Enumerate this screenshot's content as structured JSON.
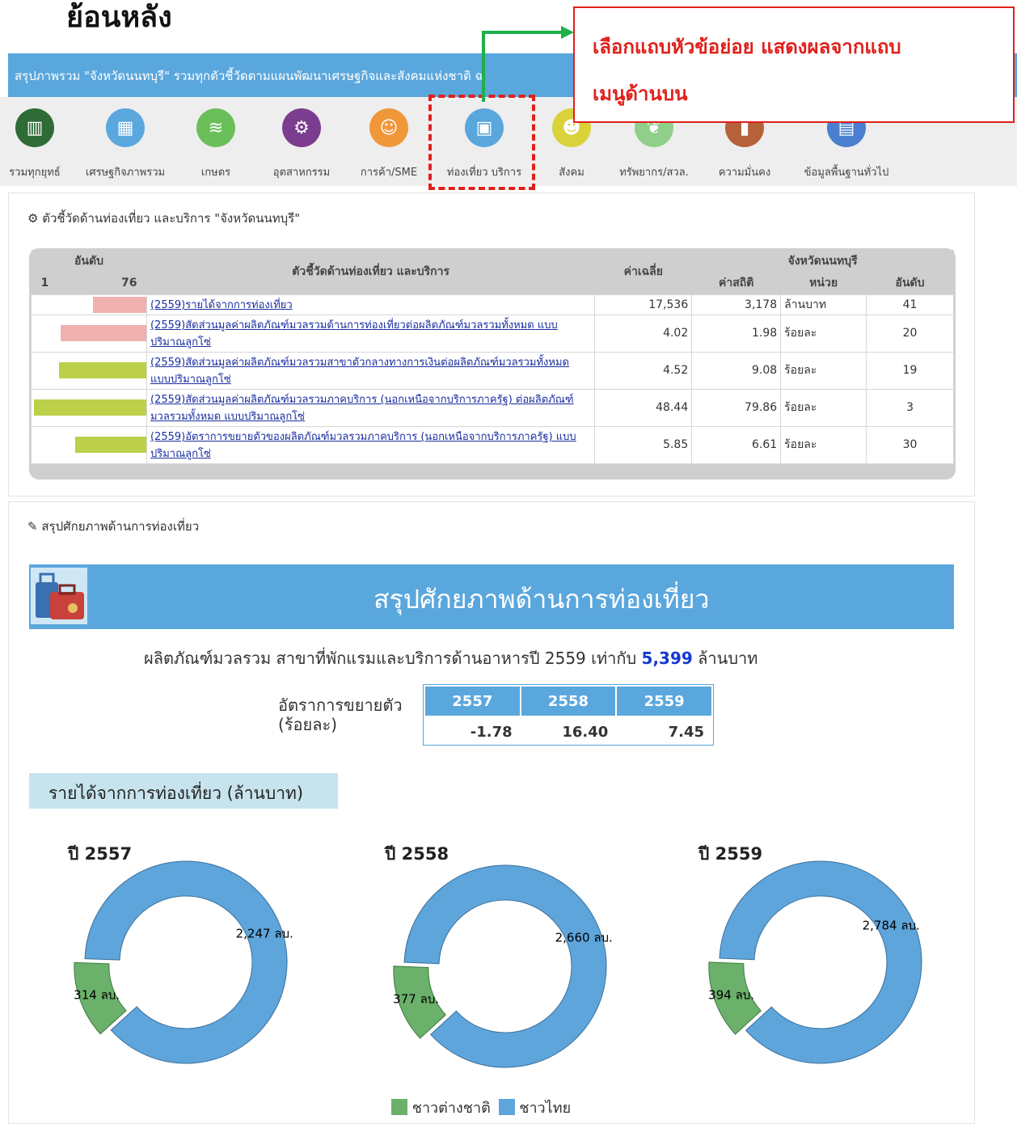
{
  "page_heading": "ย้อนหลัง",
  "banner_text": "สรุปภาพรวม \"จังหวัดนนทบุรี\" รวมทุกตัวชี้วัดตามแผนพัฒนาเศรษฐกิจและสังคมแห่งชาติ ฉ",
  "callout": {
    "line1": "เลือกแถบหัวข้อย่อย แสดงผลจากแถบ",
    "line2": "เมนูด้านบน",
    "color": "#e0201b"
  },
  "nav": [
    {
      "label": "รวมทุกยุทธ์",
      "icon": "bar-chart-icon",
      "color": "#2e6b35"
    },
    {
      "label": "เศรษฐกิจภาพรวม",
      "icon": "economy-icon",
      "color": "#5aa7dd"
    },
    {
      "label": "เกษตร",
      "icon": "farm-icon",
      "color": "#6bbf5a"
    },
    {
      "label": "อุตสาหกรรม",
      "icon": "factory-icon",
      "color": "#7a3d8f"
    },
    {
      "label": "การค้า/SME",
      "icon": "trade-icon",
      "color": "#f0973a"
    },
    {
      "label": "ท่องเที่ยว บริการ",
      "icon": "luggage-icon",
      "color": "#5aa7dd"
    },
    {
      "label": "สังคม",
      "icon": "people-icon",
      "color": "#d9d23a"
    },
    {
      "label": "ทรัพยากร/สวล.",
      "icon": "plant-icon",
      "color": "#8fcf8a"
    },
    {
      "label": "ความมั่นคง",
      "icon": "pillar-icon",
      "color": "#b5623a"
    },
    {
      "label": "ข้อมูลพื้นฐานทั่วไป",
      "icon": "document-icon",
      "color": "#4a7fd0"
    }
  ],
  "indicators_section": {
    "title": "ตัวชี้วัดด้านท่องเที่ยว และบริการ \"จังหวัดนนทบุรี\"",
    "head_rank": "อันดับ",
    "head_rank_min": "1",
    "head_rank_max": "76",
    "head_indicator": "ตัวชี้วัดด้านท่องเที่ยว และบริการ",
    "head_avg": "ค่าเฉลี่ย",
    "head_province": "จังหวัดนนทบุรี",
    "head_value": "ค่าสถิติ",
    "head_unit": "หน่วย",
    "head_rank2": "อันดับ",
    "rows": [
      {
        "name": "(2559)รายได้จากการท่องเที่ยว",
        "avg": "17,536",
        "value": "3,178",
        "unit": "ล้านบาท",
        "rank": "41",
        "bar_fraction": 0.47,
        "bar_color": "#efb0b0"
      },
      {
        "name": "(2559)สัดส่วนมูลค่าผลิตภัณฑ์มวลรวมด้านการท่องเที่ยวต่อผลิตภัณฑ์มวลรวมทั้งหมด แบบปริมาณลูกโซ่",
        "avg": "4.02",
        "value": "1.98",
        "unit": "ร้อยละ",
        "rank": "20",
        "bar_fraction": 0.76,
        "bar_color": "#efb0b0"
      },
      {
        "name": "(2559)สัดส่วนมูลค่าผลิตภัณฑ์มวลรวมสาขาตัวกลางทางการเงินต่อผลิตภัณฑ์มวลรวมทั้งหมด แบบปริมาณลูกโซ่",
        "avg": "4.52",
        "value": "9.08",
        "unit": "ร้อยละ",
        "rank": "19",
        "bar_fraction": 0.77,
        "bar_color": "#bcd04a"
      },
      {
        "name": "(2559)สัดส่วนมูลค่าผลิตภัณฑ์มวลรวมภาคบริการ (นอกเหนือจากบริการภาครัฐ) ต่อผลิตภัณฑ์มวลรวมทั้งหมด แบบปริมาณลูกโซ่",
        "avg": "48.44",
        "value": "79.86",
        "unit": "ร้อยละ",
        "rank": "3",
        "bar_fraction": 0.99,
        "bar_color": "#bcd04a"
      },
      {
        "name": "(2559)อัตราการขยายตัวของผลิตภัณฑ์มวลรวมภาคบริการ (นอกเหนือจากบริการภาครัฐ) แบบปริมาณลูกโซ่",
        "avg": "5.85",
        "value": "6.61",
        "unit": "ร้อยละ",
        "rank": "30",
        "bar_fraction": 0.63,
        "bar_color": "#bcd04a"
      }
    ]
  },
  "summary_section": {
    "head": "สรุปศักยภาพด้านการท่องเที่ยว",
    "banner_title": "สรุปศักยภาพด้านการท่องเที่ยว",
    "gdp_prefix": "ผลิตภัณฑ์มวลรวม สาขาที่พักแรมและบริการด้านอาหารปี 2559 เท่ากับ",
    "gdp_value": "5,399",
    "gdp_suffix": "ล้านบาท",
    "growth_label_1": "อัตราการขยายตัว",
    "growth_label_2": "(ร้อยละ)",
    "growth_years": [
      "2557",
      "2558",
      "2559"
    ],
    "growth_values": [
      "-1.78",
      "16.40",
      "7.45"
    ],
    "revenue_title": "รายได้จากการท่องเที่ยว (ล้านบาท)"
  },
  "chart_data": [
    {
      "type": "pie",
      "title": "ปี 2557",
      "categories": [
        "ชาวต่างชาติ",
        "ชาวไทย"
      ],
      "values": [
        314,
        2247
      ],
      "labels": [
        "314 ลบ.",
        "2,247 ลบ."
      ],
      "colors": [
        "#6bb06b",
        "#5ea5dc"
      ]
    },
    {
      "type": "pie",
      "title": "ปี 2558",
      "categories": [
        "ชาวต่างชาติ",
        "ชาวไทย"
      ],
      "values": [
        377,
        2660
      ],
      "labels": [
        "377 ลบ.",
        "2,660 ลบ."
      ],
      "colors": [
        "#6bb06b",
        "#5ea5dc"
      ]
    },
    {
      "type": "pie",
      "title": "ปี 2559",
      "categories": [
        "ชาวต่างชาติ",
        "ชาวไทย"
      ],
      "values": [
        394,
        2784
      ],
      "labels": [
        "394 ลบ.",
        "2,784 ลบ."
      ],
      "colors": [
        "#6bb06b",
        "#5ea5dc"
      ]
    }
  ],
  "legend": [
    "ชาวต่างชาติ",
    "ชาวไทย"
  ]
}
